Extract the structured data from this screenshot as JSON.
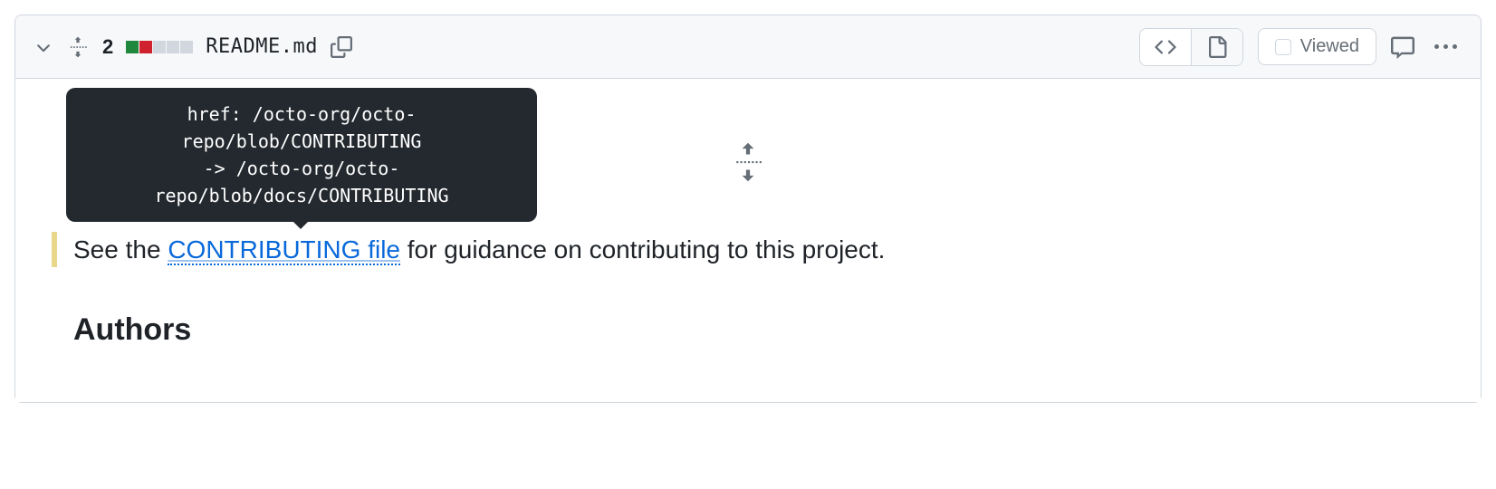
{
  "header": {
    "change_count": "2",
    "filename": "README.md",
    "viewed_label": "Viewed"
  },
  "tooltip": {
    "text": "href: /octo-org/octo-repo/blob/CONTRIBUTING\n-> /octo-org/octo-\nrepo/blob/docs/CONTRIBUTING"
  },
  "content": {
    "line_pre": "See the ",
    "link_text": "CONTRIBUTING file",
    "line_post": " for guidance on contributing to this project.",
    "heading": "Authors"
  }
}
